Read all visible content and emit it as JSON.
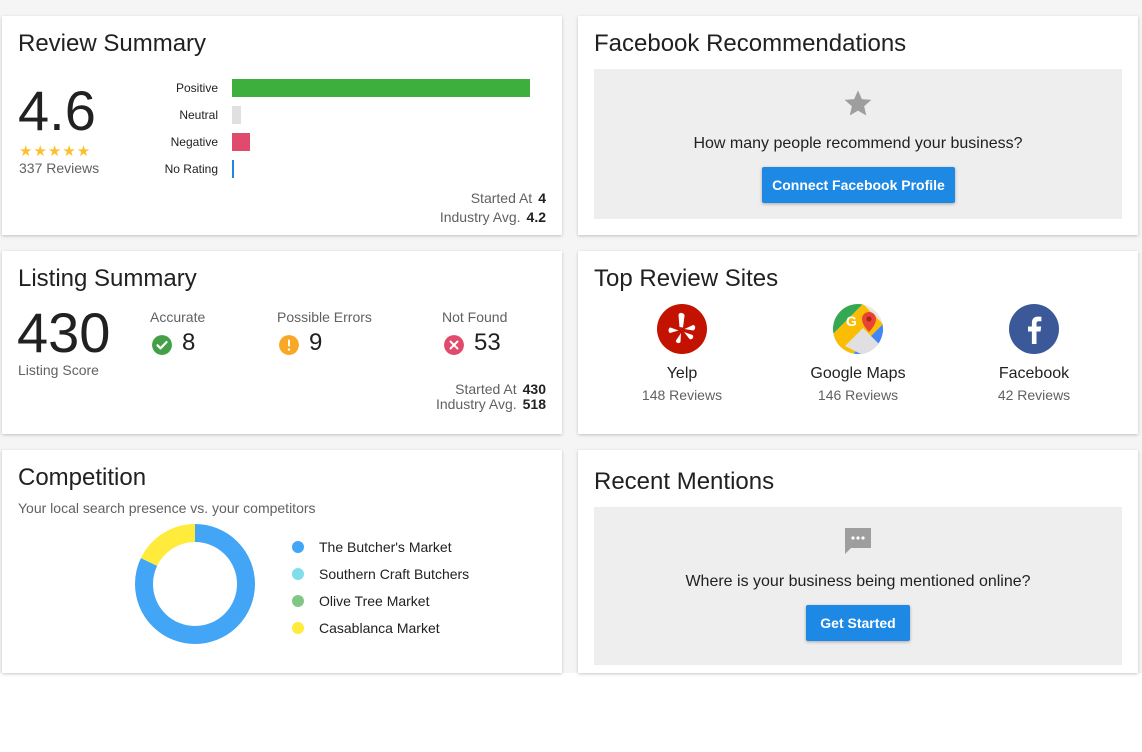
{
  "review_summary": {
    "title": "Review Summary",
    "rating": "4.6",
    "stars": "★★★★★",
    "reviews_text": "337 Reviews",
    "bars": [
      {
        "label": "Positive",
        "value": 298,
        "color": "#3daf3d"
      },
      {
        "label": "Neutral",
        "value": 9,
        "color": "#e0e0e0"
      },
      {
        "label": "Negative",
        "value": 18,
        "color": "#e04a6c"
      },
      {
        "label": "No Rating",
        "value": 1,
        "color": "#1e88e5"
      }
    ],
    "started_at_label": "Started At",
    "started_at_value": "4",
    "industry_avg_label": "Industry Avg.",
    "industry_avg_value": "4.2"
  },
  "facebook_recommendations": {
    "title": "Facebook Recommendations",
    "icon": "star-icon",
    "question": "How many people recommend your business?",
    "button_label": "Connect Facebook Profile"
  },
  "listing_summary": {
    "title": "Listing Summary",
    "score": "430",
    "score_label": "Listing Score",
    "columns": [
      {
        "label": "Accurate",
        "value": "8",
        "icon": "check-circle-icon",
        "color": "#43a047"
      },
      {
        "label": "Possible Errors",
        "value": "9",
        "icon": "warning-circle-icon",
        "color": "#f9a825"
      },
      {
        "label": "Not Found",
        "value": "53",
        "icon": "error-circle-icon",
        "color": "#e04a6c"
      }
    ],
    "started_at_label": "Started At",
    "started_at_value": "430",
    "industry_avg_label": "Industry Avg.",
    "industry_avg_value": "518"
  },
  "top_review_sites": {
    "title": "Top Review Sites",
    "sites": [
      {
        "name": "Yelp",
        "reviews": "148 Reviews",
        "icon": "yelp-icon",
        "color": "#c41200"
      },
      {
        "name": "Google Maps",
        "reviews": "146 Reviews",
        "icon": "google-maps-icon",
        "color": "#34a853"
      },
      {
        "name": "Facebook",
        "reviews": "42 Reviews",
        "icon": "facebook-icon",
        "color": "#3b5998"
      }
    ]
  },
  "competition": {
    "title": "Competition",
    "subtitle": "Your local search presence vs. your competitors",
    "legend": [
      {
        "name": "The Butcher's Market",
        "color": "#42a5f5"
      },
      {
        "name": "Southern Craft Butchers",
        "color": "#80deea"
      },
      {
        "name": "Olive Tree Market",
        "color": "#81c784"
      },
      {
        "name": "Casablanca Market",
        "color": "#ffeb3b"
      }
    ]
  },
  "chart_data": {
    "type": "pie",
    "variant": "donut",
    "categories": [
      "The Butcher's Market",
      "Southern Craft Butchers",
      "Olive Tree Market",
      "Casablanca Market"
    ],
    "values": [
      82,
      0,
      0,
      18
    ],
    "colors": [
      "#42a5f5",
      "#80deea",
      "#81c784",
      "#ffeb3b"
    ],
    "title": "Competition",
    "legend": "right"
  },
  "recent_mentions": {
    "title": "Recent Mentions",
    "icon": "chat-bubble-icon",
    "question": "Where is your business being mentioned online?",
    "button_label": "Get Started"
  }
}
